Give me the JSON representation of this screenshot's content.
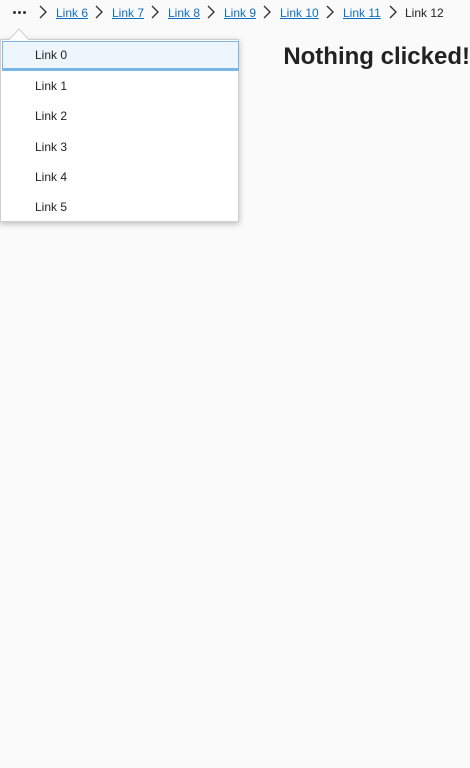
{
  "breadcrumb": {
    "overflow_icon": "more-horizontal-icon",
    "separator_icon": "chevron-right-icon",
    "links": [
      "Link 6",
      "Link 7",
      "Link 8",
      "Link 9",
      "Link 10",
      "Link 11"
    ],
    "current": "Link 12"
  },
  "overflow_menu": {
    "items": [
      "Link 0",
      "Link 1",
      "Link 2",
      "Link 3",
      "Link 4",
      "Link 5"
    ],
    "focused_index": 0
  },
  "main": {
    "status": "Nothing clicked!"
  },
  "colors": {
    "link": "#0b6fc4",
    "focus_border": "#7bb6e8",
    "focus_fill": "#eef5fb",
    "background": "#fafafa"
  }
}
